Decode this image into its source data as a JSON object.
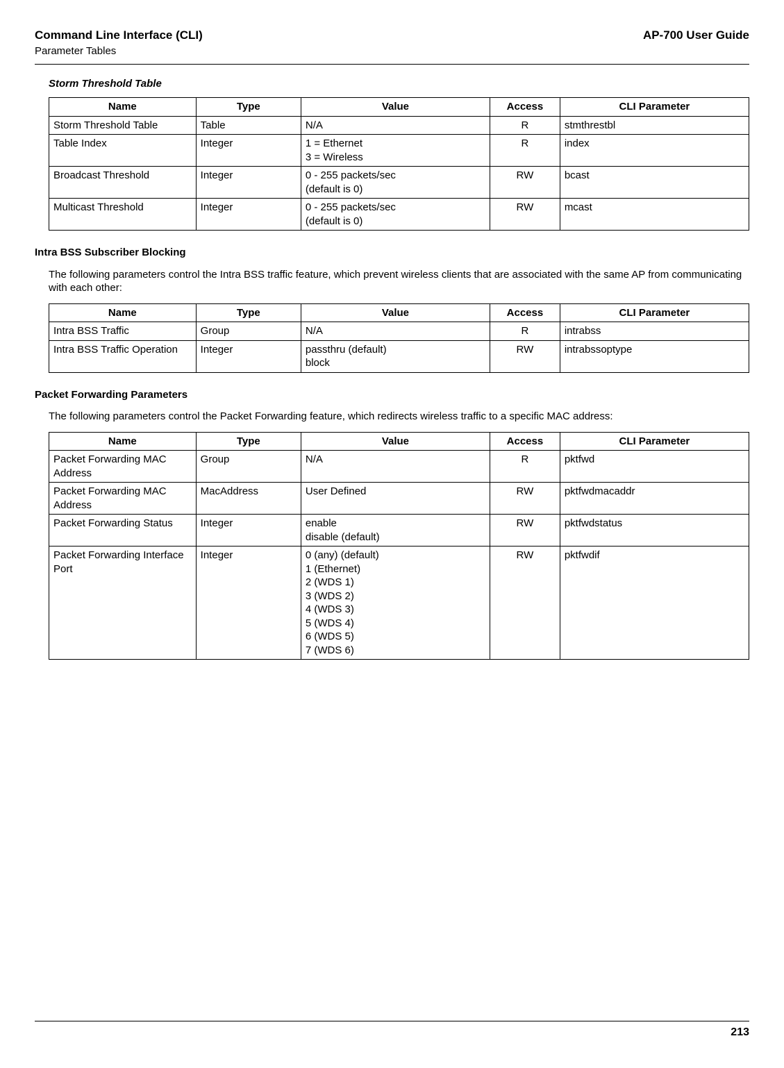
{
  "header": {
    "left_title": "Command Line Interface (CLI)",
    "left_sub": "Parameter Tables",
    "right": "AP-700 User Guide"
  },
  "storm": {
    "title": "Storm Threshold Table",
    "cols": [
      "Name",
      "Type",
      "Value",
      "Access",
      "CLI Parameter"
    ],
    "rows": [
      {
        "name": "Storm Threshold Table",
        "type": "Table",
        "value": "N/A",
        "access": "R",
        "cli": "stmthrestbl"
      },
      {
        "name": "Table Index",
        "type": "Integer",
        "value": "1 = Ethernet\n3 = Wireless",
        "access": "R",
        "cli": "index"
      },
      {
        "name": "Broadcast Threshold",
        "type": "Integer",
        "value": "0 - 255 packets/sec\n(default is 0)",
        "access": "RW",
        "cli": "bcast"
      },
      {
        "name": "Multicast Threshold",
        "type": "Integer",
        "value": "0 - 255 packets/sec\n(default is 0)",
        "access": "RW",
        "cli": "mcast"
      }
    ]
  },
  "intra": {
    "heading": "Intra BSS Subscriber Blocking",
    "text": "The following parameters control the Intra BSS traffic feature, which prevent wireless clients that are associated with the same AP from communicating with each other:",
    "cols": [
      "Name",
      "Type",
      "Value",
      "Access",
      "CLI Parameter"
    ],
    "rows": [
      {
        "name": "Intra BSS Traffic",
        "type": "Group",
        "value": "N/A",
        "access": "R",
        "cli": "intrabss"
      },
      {
        "name": "Intra BSS Traffic Operation",
        "type": "Integer",
        "value": "passthru (default)\nblock",
        "access": "RW",
        "cli": "intrabssoptype"
      }
    ]
  },
  "pktfwd": {
    "heading": "Packet Forwarding Parameters",
    "text": "The following parameters control the Packet Forwarding feature, which redirects wireless traffic to a specific MAC address:",
    "cols": [
      "Name",
      "Type",
      "Value",
      "Access",
      "CLI Parameter"
    ],
    "rows": [
      {
        "name": "Packet Forwarding MAC Address",
        "type": "Group",
        "value": "N/A",
        "access": "R",
        "cli": "pktfwd"
      },
      {
        "name": "Packet Forwarding MAC Address",
        "type": "MacAddress",
        "value": "User Defined",
        "access": "RW",
        "cli": "pktfwdmacaddr"
      },
      {
        "name": "Packet Forwarding Status",
        "type": "Integer",
        "value": "enable\ndisable (default)",
        "access": "RW",
        "cli": "pktfwdstatus"
      },
      {
        "name": "Packet Forwarding Interface Port",
        "type": "Integer",
        "value": "0 (any) (default)\n1 (Ethernet)\n2 (WDS 1)\n3 (WDS 2)\n4 (WDS 3)\n5 (WDS 4)\n6 (WDS 5)\n7 (WDS 6)",
        "access": "RW",
        "cli": "pktfwdif"
      }
    ]
  },
  "footer": {
    "page": "213"
  }
}
